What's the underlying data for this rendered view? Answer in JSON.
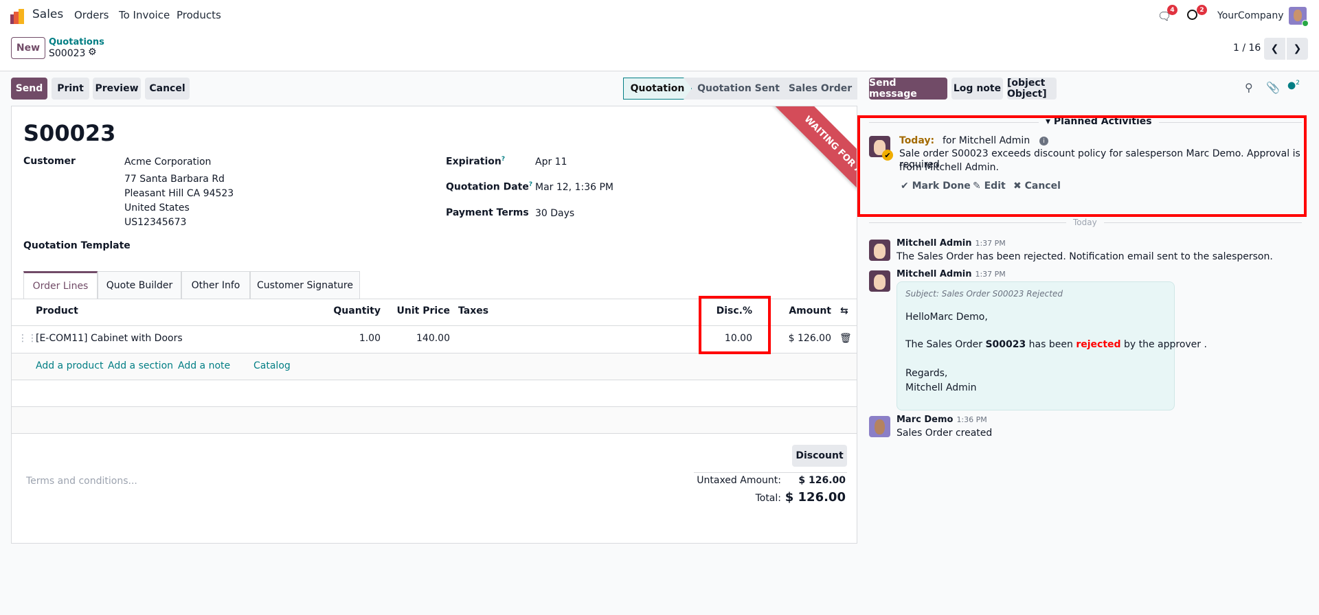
{
  "navbar": {
    "app": "Sales",
    "menu": [
      "Orders",
      "To Invoice",
      "Products"
    ],
    "messages_count": "4",
    "activities_count": "2",
    "company": "YourCompany"
  },
  "breadcrumb": {
    "new_label": "New",
    "parent": "Quotations",
    "current": "S00023"
  },
  "pager": {
    "text": "1 / 16"
  },
  "actions": {
    "send": "Send",
    "print": "Print",
    "preview": "Preview",
    "cancel": "Cancel"
  },
  "statusbar": {
    "stages": [
      "Quotation",
      "Quotation Sent",
      "Sales Order"
    ],
    "active": "Quotation"
  },
  "ribbon": "WAITING FOR APPROVAL",
  "form": {
    "title": "S00023",
    "customer_label": "Customer",
    "customer_lines": [
      "Acme Corporation",
      "77 Santa Barbara Rd",
      "Pleasant Hill CA 94523",
      "United States",
      "US12345673"
    ],
    "expiration_label": "Expiration",
    "expiration": "Apr 11",
    "quotation_date_label": "Quotation Date",
    "quotation_date": "Mar 12, 1:36 PM",
    "payment_terms_label": "Payment Terms",
    "payment_terms": "30 Days",
    "template_label": "Quotation Template",
    "help_mark": "?"
  },
  "tabs": [
    "Order Lines",
    "Quote Builder",
    "Other Info",
    "Customer Signature"
  ],
  "order_lines": {
    "headers": {
      "product": "Product",
      "quantity": "Quantity",
      "unit_price": "Unit Price",
      "taxes": "Taxes",
      "discount": "Disc.%",
      "amount": "Amount"
    },
    "rows": [
      {
        "product": "[E-COM11] Cabinet with Doors",
        "quantity": "1.00",
        "unit_price": "140.00",
        "taxes": "",
        "discount": "10.00",
        "amount": "$ 126.00"
      }
    ],
    "add_links": [
      "Add a product",
      "Add a section",
      "Add a note",
      "Catalog"
    ]
  },
  "footer": {
    "terms_placeholder": "Terms and conditions...",
    "discount_button": "Discount",
    "untaxed_label": "Untaxed Amount:",
    "untaxed": "$ 126.00",
    "total_label": "Total:",
    "total": "$ 126.00"
  },
  "chatter": {
    "send_message": "Send message",
    "log_note": "Log note",
    "activity": {
      "due": "Today:",
      "assignee": "for Mitchell Admin",
      "summary": "Sale order S00023 exceeds discount policy for salesperson Marc Demo. Approval is required",
      "summary2": "from Mitchell Admin.",
      "mark_done": "Mark Done",
      "edit": "Edit",
      "cancel": "Cancel"
    },
    "followers_count": "2",
    "planned_title": "Planned Activities",
    "separator": "Today",
    "messages": [
      {
        "author": "Mitchell Admin",
        "time": "1:37 PM",
        "body": "The Sales Order has been rejected. Notification email sent to the salesperson."
      },
      {
        "author": "Mitchell Admin",
        "time": "1:37 PM",
        "subject": "Subject: Sales Order S00023 Rejected",
        "greeting": "HelloMarc Demo,",
        "line_pre": "The Sales Order ",
        "line_ref": "S00023",
        "line_mid": " has been ",
        "line_status": "rejected",
        "line_post": " by the approver .",
        "regards": "Regards,",
        "signature": "Mitchell Admin"
      },
      {
        "author": "Marc Demo",
        "time": "1:36 PM",
        "body": "Sales Order created"
      }
    ]
  },
  "colors": {
    "brand": "#714b67",
    "link": "#017e84",
    "ribbon": "#d44c59",
    "highlight": "#ff0000",
    "today": "#a36a00"
  }
}
